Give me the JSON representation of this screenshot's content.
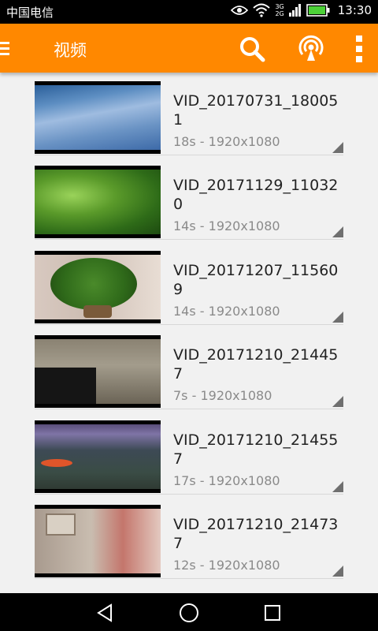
{
  "status_bar": {
    "carrier": "中国电信",
    "network_3g_top": "3G",
    "network_3g_bottom": "2G",
    "time": "13:30"
  },
  "app_bar": {
    "title": "视频",
    "icons": [
      "menu-icon",
      "search-icon",
      "cast-icon",
      "more-vert-icon"
    ]
  },
  "colors": {
    "accent": "#ff8800",
    "text_primary": "#222222",
    "text_secondary": "#8a8a8a",
    "background": "#f1f1f1"
  },
  "videos": [
    {
      "title": "VID_20170731_180051",
      "meta": "18s - 1920x1080"
    },
    {
      "title": "VID_20171129_110320",
      "meta": "14s - 1920x1080"
    },
    {
      "title": "VID_20171207_115609",
      "meta": "14s - 1920x1080"
    },
    {
      "title": "VID_20171210_214457",
      "meta": "7s - 1920x1080"
    },
    {
      "title": "VID_20171210_214557",
      "meta": "17s - 1920x1080"
    },
    {
      "title": "VID_20171210_214737",
      "meta": "12s - 1920x1080"
    }
  ],
  "nav_bar": {
    "icons": [
      "back-icon",
      "home-icon",
      "recent-apps-icon"
    ]
  }
}
